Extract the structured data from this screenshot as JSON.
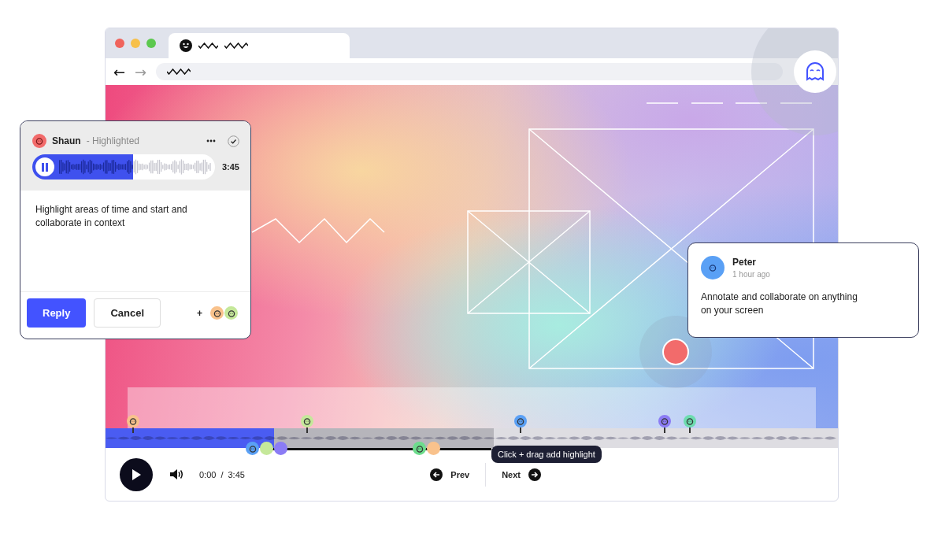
{
  "browser": {
    "back": "←",
    "forward": "→"
  },
  "timeline": {
    "level": 0.23,
    "pins": [
      {
        "color": "#f9c28c"
      },
      {
        "color": "#c5e89a"
      },
      {
        "color": "#5aa0f5"
      },
      {
        "color": "#8b7cf5"
      },
      {
        "color": "#6ddcb0"
      }
    ],
    "clusters": [
      {
        "avatars": [
          {
            "color": "#5aa0f5"
          },
          {
            "color": "#c5e89a"
          },
          {
            "color": "#8b7cf5"
          }
        ]
      },
      {
        "avatars": [
          {
            "color": "#6ddc8c"
          },
          {
            "color": "#f9c28c"
          }
        ]
      }
    ],
    "tooltip": "Click + drag add highlight"
  },
  "player": {
    "playing": false,
    "time": "0:00",
    "separator": "/",
    "duration": "3:45",
    "prev": "Prev",
    "next": "Next"
  },
  "comment_card": {
    "author": "Shaun",
    "status": "- Highlighted",
    "playing": true,
    "level": 0.55,
    "duration": "3:45",
    "body": "Highlight areas of time and start and collaborate in context",
    "buttons": [
      "Reply",
      "Cancel"
    ],
    "plus": "+",
    "avatars": [
      {
        "color": "#f9c28c"
      },
      {
        "color": "#c5e89a"
      }
    ]
  },
  "note": {
    "author": "Peter",
    "time": "1 hour ago",
    "body": "Annotate and collaborate on anything on your screen"
  }
}
